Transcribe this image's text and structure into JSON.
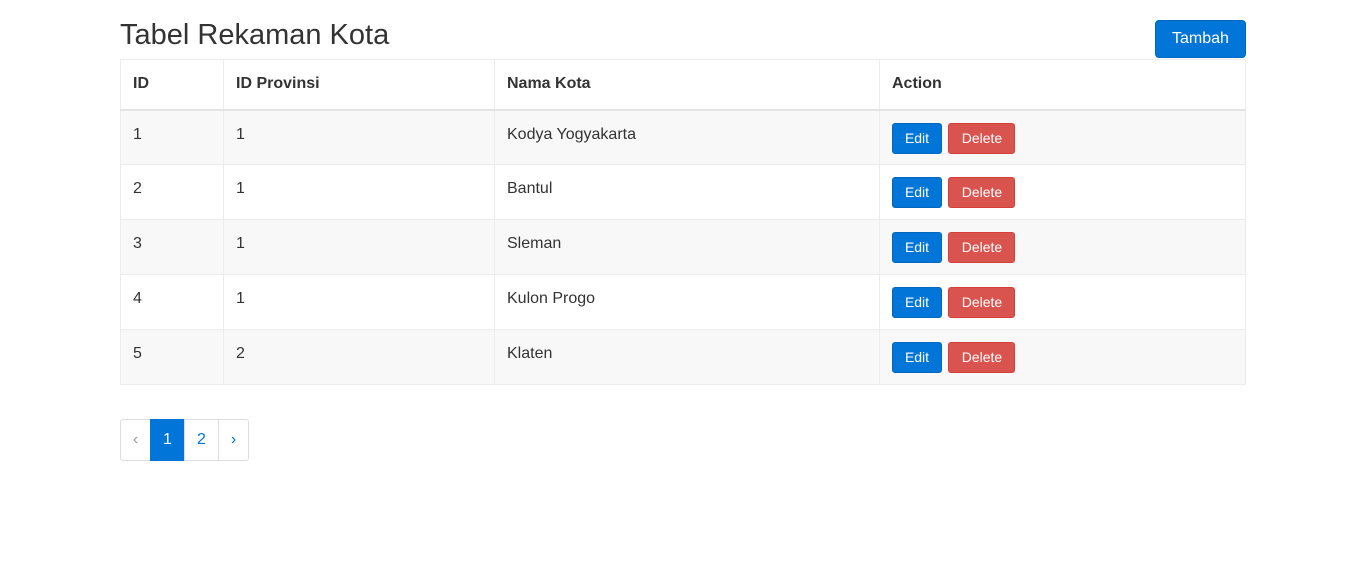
{
  "page": {
    "title": "Tabel Rekaman Kota",
    "add_button_label": "Tambah"
  },
  "table": {
    "columns": [
      "ID",
      "ID Provinsi",
      "Nama Kota",
      "Action"
    ],
    "rows": [
      {
        "id": "1",
        "id_provinsi": "1",
        "nama_kota": "Kodya Yogyakarta",
        "edit": "Edit",
        "delete": "Delete"
      },
      {
        "id": "2",
        "id_provinsi": "1",
        "nama_kota": "Bantul",
        "edit": "Edit",
        "delete": "Delete"
      },
      {
        "id": "3",
        "id_provinsi": "1",
        "nama_kota": "Sleman",
        "edit": "Edit",
        "delete": "Delete"
      },
      {
        "id": "4",
        "id_provinsi": "1",
        "nama_kota": "Kulon Progo",
        "edit": "Edit",
        "delete": "Delete"
      },
      {
        "id": "5",
        "id_provinsi": "2",
        "nama_kota": "Klaten",
        "edit": "Edit",
        "delete": "Delete"
      }
    ]
  },
  "pagination": {
    "prev": "‹",
    "pages": [
      "1",
      "2"
    ],
    "current": "1",
    "next": "›"
  },
  "colors": {
    "primary": "#0275d8",
    "danger": "#d9534f",
    "stripe": "#f8f8f8",
    "text": "#333333"
  }
}
